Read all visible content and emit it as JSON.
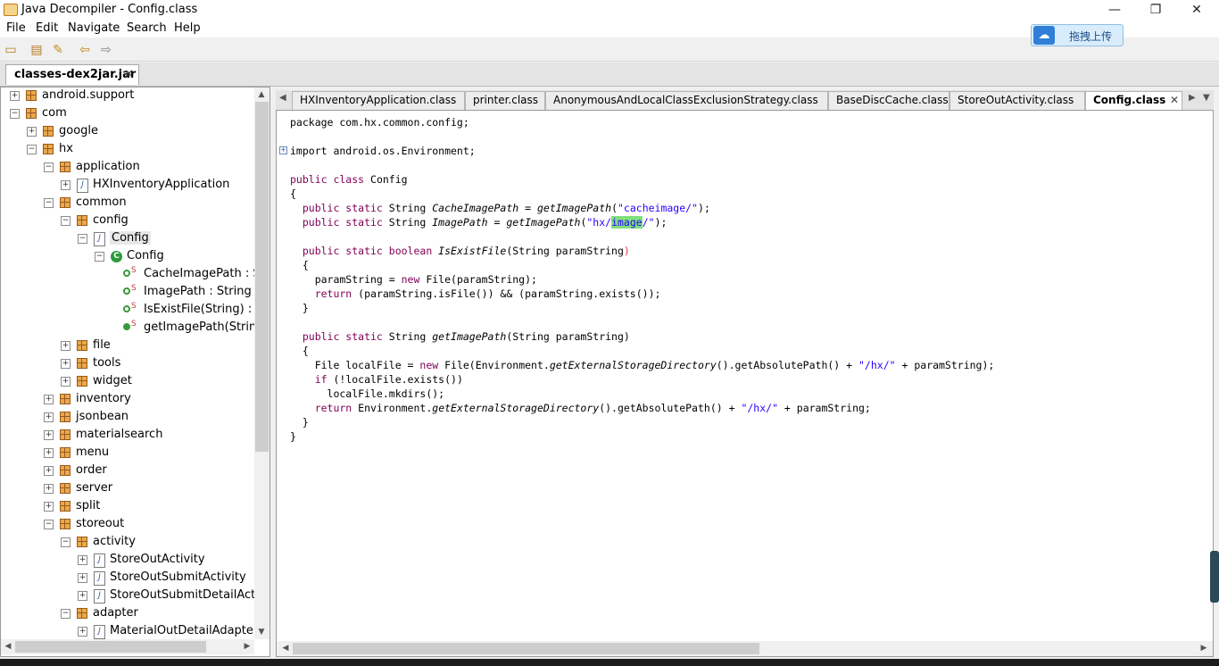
{
  "window": {
    "title": "Java Decompiler - Config.class",
    "minimize": "—",
    "restore": "❐",
    "close": "✕"
  },
  "menu": [
    "File",
    "Edit",
    "Navigate",
    "Search",
    "Help"
  ],
  "toolbar": {
    "icons": [
      "open-file-icon",
      "open-folder-icon",
      "edit-icon",
      "back-arrow-icon",
      "forward-arrow-icon"
    ]
  },
  "cloud_upload": {
    "label": "拖拽上传"
  },
  "file_tab": {
    "label": "classes-dex2jar.jar",
    "close": "✕"
  },
  "tree": [
    {
      "label": "android.support",
      "indent": 0,
      "toggle": "+",
      "icon": "package"
    },
    {
      "label": "com",
      "indent": 0,
      "toggle": "−",
      "icon": "package"
    },
    {
      "label": "google",
      "indent": 1,
      "toggle": "+",
      "icon": "package"
    },
    {
      "label": "hx",
      "indent": 1,
      "toggle": "−",
      "icon": "package"
    },
    {
      "label": "application",
      "indent": 2,
      "toggle": "−",
      "icon": "package"
    },
    {
      "label": "HXInventoryApplication",
      "indent": 3,
      "toggle": "+",
      "icon": "java"
    },
    {
      "label": "common",
      "indent": 2,
      "toggle": "−",
      "icon": "package"
    },
    {
      "label": "config",
      "indent": 3,
      "toggle": "−",
      "icon": "package"
    },
    {
      "label": "Config",
      "indent": 4,
      "toggle": "−",
      "icon": "java",
      "selected": true
    },
    {
      "label": "Config",
      "indent": 5,
      "toggle": "−",
      "icon": "class"
    },
    {
      "label": "CacheImagePath : Str",
      "indent": 6,
      "toggle": "",
      "icon": "field"
    },
    {
      "label": "ImagePath : String",
      "indent": 6,
      "toggle": "",
      "icon": "field"
    },
    {
      "label": "IsExistFile(String) : bc",
      "indent": 6,
      "toggle": "",
      "icon": "field"
    },
    {
      "label": "getImagePath(String)",
      "indent": 6,
      "toggle": "",
      "icon": "method"
    },
    {
      "label": "file",
      "indent": 3,
      "toggle": "+",
      "icon": "package"
    },
    {
      "label": "tools",
      "indent": 3,
      "toggle": "+",
      "icon": "package"
    },
    {
      "label": "widget",
      "indent": 3,
      "toggle": "+",
      "icon": "package"
    },
    {
      "label": "inventory",
      "indent": 2,
      "toggle": "+",
      "icon": "package"
    },
    {
      "label": "jsonbean",
      "indent": 2,
      "toggle": "+",
      "icon": "package"
    },
    {
      "label": "materialsearch",
      "indent": 2,
      "toggle": "+",
      "icon": "package"
    },
    {
      "label": "menu",
      "indent": 2,
      "toggle": "+",
      "icon": "package"
    },
    {
      "label": "order",
      "indent": 2,
      "toggle": "+",
      "icon": "package"
    },
    {
      "label": "server",
      "indent": 2,
      "toggle": "+",
      "icon": "package"
    },
    {
      "label": "split",
      "indent": 2,
      "toggle": "+",
      "icon": "package"
    },
    {
      "label": "storeout",
      "indent": 2,
      "toggle": "−",
      "icon": "package"
    },
    {
      "label": "activity",
      "indent": 3,
      "toggle": "−",
      "icon": "package"
    },
    {
      "label": "StoreOutActivity",
      "indent": 4,
      "toggle": "+",
      "icon": "java"
    },
    {
      "label": "StoreOutSubmitActivity",
      "indent": 4,
      "toggle": "+",
      "icon": "java"
    },
    {
      "label": "StoreOutSubmitDetailActivit",
      "indent": 4,
      "toggle": "+",
      "icon": "java"
    },
    {
      "label": "adapter",
      "indent": 3,
      "toggle": "−",
      "icon": "package"
    },
    {
      "label": "MaterialOutDetailAdapter",
      "indent": 4,
      "toggle": "+",
      "icon": "java"
    }
  ],
  "editor_tabs": [
    {
      "label": "HXInventoryApplication.class"
    },
    {
      "label": "printer.class"
    },
    {
      "label": "AnonymousAndLocalClassExclusionStrategy.class"
    },
    {
      "label": "BaseDiscCache.class"
    },
    {
      "label": "StoreOutActivity.class"
    },
    {
      "label": "Config.class",
      "active": true
    }
  ],
  "code": [
    [
      [
        "package com.hx.common.config;",
        ""
      ]
    ],
    [],
    [
      [
        "import android.os.Environment;",
        ""
      ]
    ],
    [],
    [
      [
        "public class ",
        "kw"
      ],
      [
        "Config",
        ""
      ]
    ],
    [
      [
        "{",
        ""
      ]
    ],
    [
      [
        "  public static ",
        "kw"
      ],
      [
        "String ",
        ""
      ],
      [
        "CacheImagePath",
        "it"
      ],
      [
        " = ",
        ""
      ],
      [
        "getImagePath",
        "it"
      ],
      [
        "(",
        ""
      ],
      [
        "\"cacheimage/\"",
        "str"
      ],
      [
        ");",
        ""
      ]
    ],
    [
      [
        "  public static ",
        "kw"
      ],
      [
        "String ",
        ""
      ],
      [
        "ImagePath",
        "it"
      ],
      [
        " = ",
        ""
      ],
      [
        "getImagePath",
        "it"
      ],
      [
        "(",
        ""
      ],
      [
        "\"hx/",
        "str"
      ],
      [
        "image",
        "hl"
      ],
      [
        "/\"",
        "str"
      ],
      [
        ");",
        ""
      ]
    ],
    [],
    [
      [
        "  public static boolean ",
        "kw"
      ],
      [
        "IsExistFile",
        "it"
      ],
      [
        "(String paramString",
        ""
      ],
      [
        ")",
        "paren"
      ]
    ],
    [
      [
        "  {",
        ""
      ]
    ],
    [
      [
        "    paramString = ",
        ""
      ],
      [
        "new ",
        "kw"
      ],
      [
        "File(paramString);",
        ""
      ]
    ],
    [
      [
        "    return ",
        "kw"
      ],
      [
        "(paramString.isFile()) && (paramString.exists());",
        ""
      ]
    ],
    [
      [
        "  }",
        ""
      ]
    ],
    [],
    [
      [
        "  public static ",
        "kw"
      ],
      [
        "String ",
        ""
      ],
      [
        "getImagePath",
        "it"
      ],
      [
        "(String paramString)",
        ""
      ]
    ],
    [
      [
        "  {",
        ""
      ]
    ],
    [
      [
        "    File localFile = ",
        ""
      ],
      [
        "new ",
        "kw"
      ],
      [
        "File(Environment.",
        ""
      ],
      [
        "getExternalStorageDirectory",
        "it"
      ],
      [
        "().getAbsolutePath() + ",
        ""
      ],
      [
        "\"/hx/\"",
        "str"
      ],
      [
        " + paramString);",
        ""
      ]
    ],
    [
      [
        "    if ",
        "kw"
      ],
      [
        "(!localFile.exists())",
        ""
      ]
    ],
    [
      [
        "      localFile.mkdirs();",
        ""
      ]
    ],
    [
      [
        "    return ",
        "kw"
      ],
      [
        "Environment.",
        ""
      ],
      [
        "getExternalStorageDirectory",
        "it"
      ],
      [
        "().getAbsolutePath() + ",
        ""
      ],
      [
        "\"/hx/\"",
        "str"
      ],
      [
        " + paramString;",
        ""
      ]
    ],
    [
      [
        "  }",
        ""
      ]
    ],
    [
      [
        "}",
        ""
      ]
    ]
  ]
}
